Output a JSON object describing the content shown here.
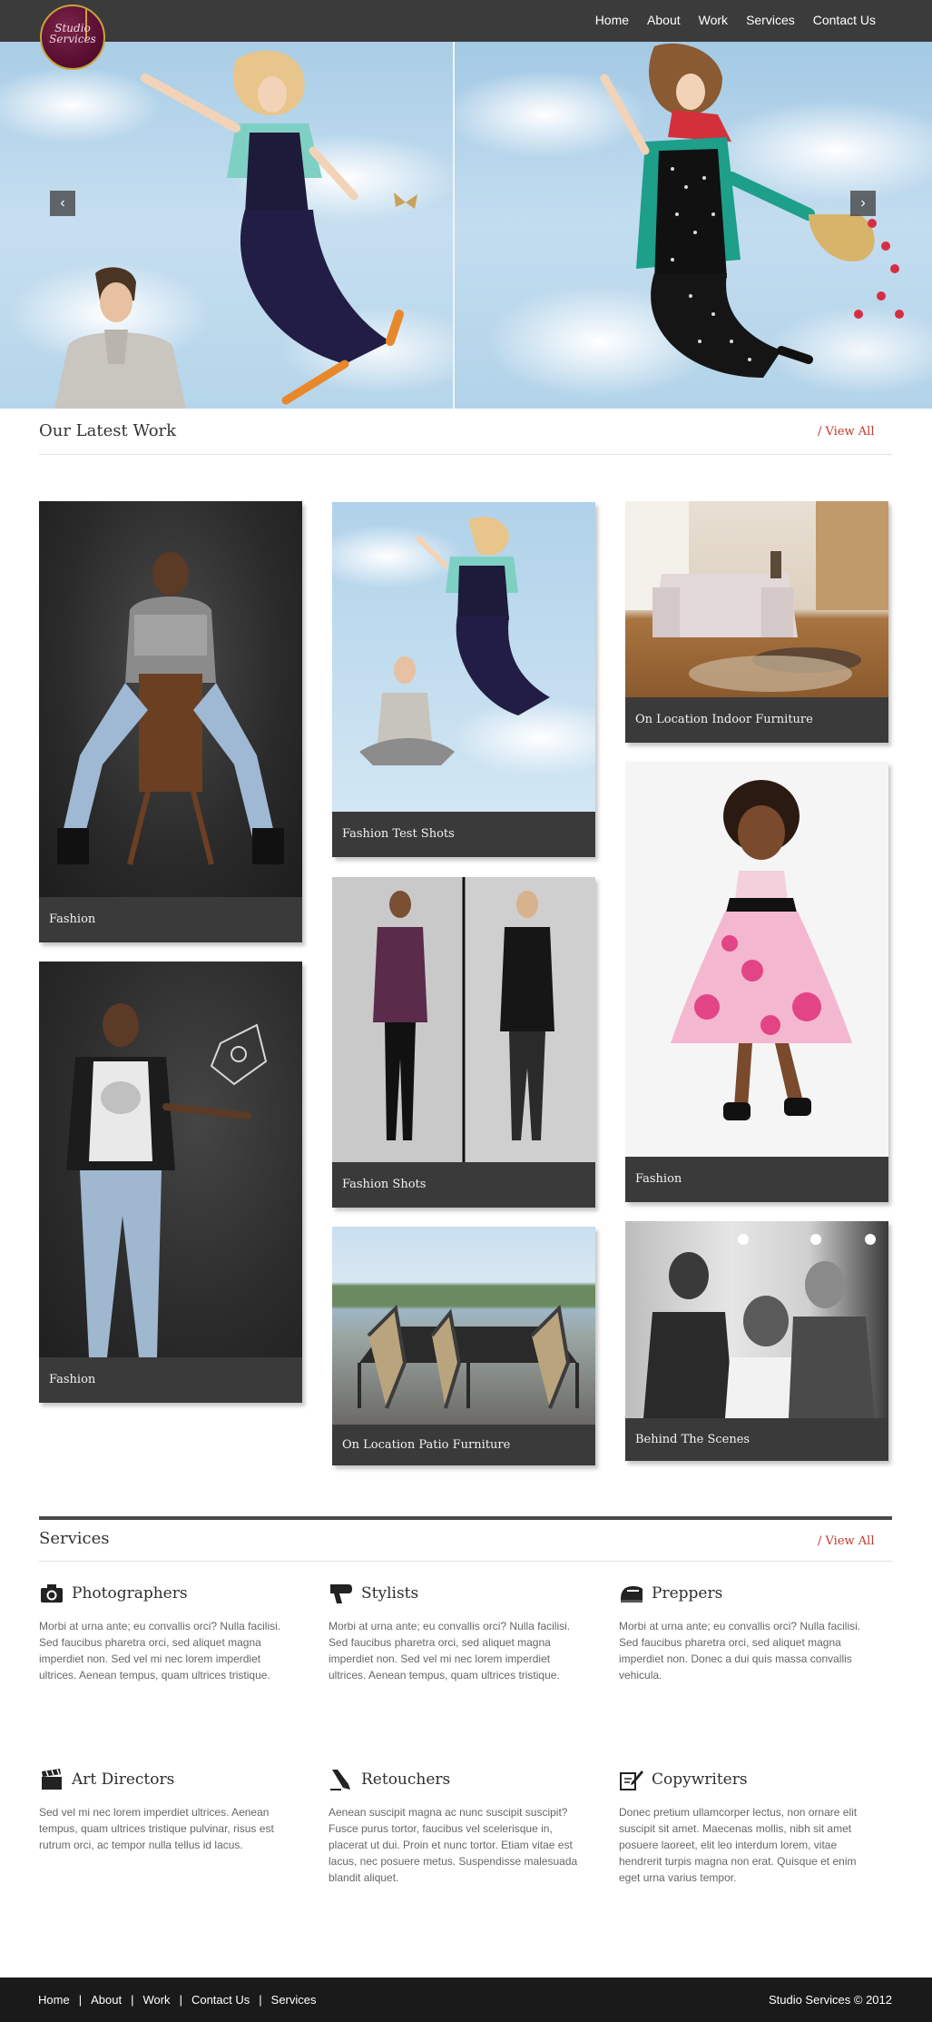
{
  "brand": {
    "logo_line1": "Studio",
    "logo_line2": "Services"
  },
  "nav": {
    "items": [
      "Home",
      "About",
      "Work",
      "Services",
      "Contact Us"
    ]
  },
  "hero": {
    "prev_label": "‹",
    "next_label": "›"
  },
  "latest_work": {
    "title": "Our Latest Work",
    "view_all": "/ View All",
    "items": [
      {
        "caption": "Fashion"
      },
      {
        "caption": "Fashion Test Shots"
      },
      {
        "caption": "On Location Indoor Furniture"
      },
      {
        "caption": "Fashion"
      },
      {
        "caption": "Fashion Shots"
      },
      {
        "caption": "Fashion"
      },
      {
        "caption": "On Location Patio Furniture"
      },
      {
        "caption": "Behind The Scenes"
      }
    ]
  },
  "services": {
    "title": "Services",
    "view_all": "/ View All",
    "items": [
      {
        "title": "Photographers",
        "icon": "camera-icon",
        "text": "Morbi at urna ante; eu convallis orci? Nulla facilisi. Sed faucibus pharetra orci, sed aliquet magna imperdiet non. Sed vel mi nec lorem imperdiet ultrices. Aenean tempus, quam ultrices tristique."
      },
      {
        "title": "Stylists",
        "icon": "hair-dryer-icon",
        "text": "Morbi at urna ante; eu convallis orci? Nulla facilisi. Sed faucibus pharetra orci, sed aliquet magna imperdiet non. Sed vel mi nec lorem imperdiet ultrices. Aenean tempus, quam ultrices tristique."
      },
      {
        "title": "Preppers",
        "icon": "iron-icon",
        "text": "Morbi at urna ante; eu convallis orci? Nulla facilisi. Sed faucibus pharetra orci, sed aliquet magna imperdiet non. Donec a dui quis massa convallis vehicula."
      },
      {
        "title": "Art Directors",
        "icon": "clapperboard-icon",
        "text": "Sed vel mi nec lorem imperdiet ultrices. Aenean tempus, quam ultrices tristique pulvinar, risus est rutrum orci, ac tempor nulla tellus id lacus."
      },
      {
        "title": "Retouchers",
        "icon": "marker-icon",
        "text": "Aenean suscipit magna ac nunc suscipit suscipit? Fusce purus tortor, faucibus vel scelerisque in, placerat ut dui. Proin et nunc tortor. Etiam vitae est lacus, nec posuere metus. Suspendisse malesuada blandit aliquet."
      },
      {
        "title": "Copywriters",
        "icon": "edit-document-icon",
        "text": "Donec pretium ullamcorper lectus, non ornare elit suscipit sit amet. Maecenas mollis, nibh sit amet posuere laoreet, elit leo interdum lorem, vitae hendrerit turpis magna non erat. Quisque et enim eget urna varius tempor."
      }
    ]
  },
  "footer": {
    "links": [
      "Home",
      "About",
      "Work",
      "Contact Us",
      "Services"
    ],
    "separator": "|",
    "copyright": "Studio Services © 2012"
  },
  "colors": {
    "header_bg": "#3b3b3b",
    "accent": "#c0392b",
    "caption_bg": "#3a3a3a",
    "footer_bg": "#1a1a1a"
  }
}
